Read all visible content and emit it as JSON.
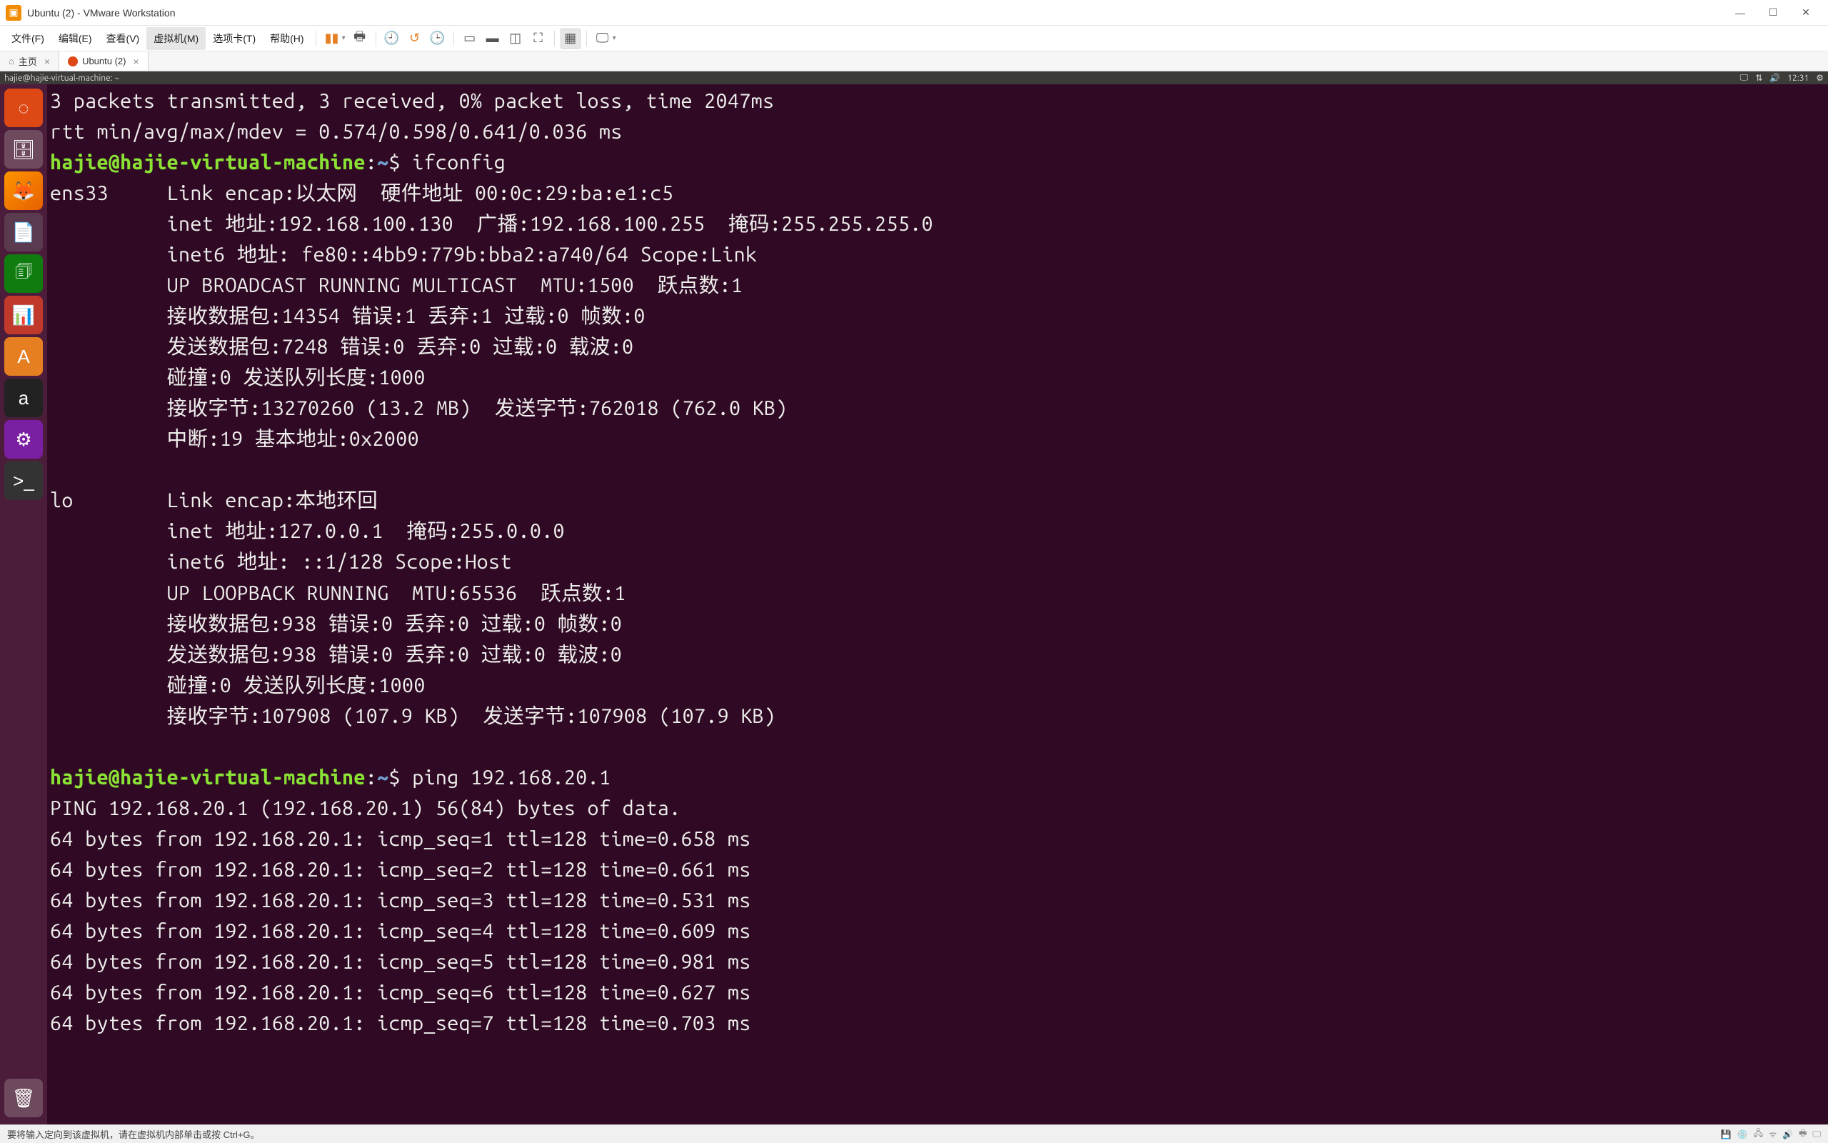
{
  "window": {
    "title": "Ubuntu (2) - VMware Workstation",
    "min_label": "—",
    "max_label": "☐",
    "close_label": "✕"
  },
  "menu": {
    "file": "文件(F)",
    "edit": "编辑(E)",
    "view": "查看(V)",
    "vm": "虚拟机(M)",
    "tabs": "选项卡(T)",
    "help": "帮助(H)"
  },
  "tabs": {
    "home": "主页",
    "vm": "Ubuntu (2)"
  },
  "ubuntu_topbar": {
    "title": "hajie@hajie-virtual-machine: ~",
    "time": "12:31"
  },
  "terminal": {
    "prompt_user": "hajie@hajie-virtual-machine",
    "prompt_path": "~",
    "prompt_dollar": "$",
    "lines_before": [
      "3 packets transmitted, 3 received, 0% packet loss, time 2047ms",
      "rtt min/avg/max/mdev = 0.574/0.598/0.641/0.036 ms"
    ],
    "cmd1": "ifconfig",
    "ifconfig_lines": [
      "ens33     Link encap:以太网  硬件地址 00:0c:29:ba:e1:c5  ",
      "          inet 地址:192.168.100.130  广播:192.168.100.255  掩码:255.255.255.0",
      "          inet6 地址: fe80::4bb9:779b:bba2:a740/64 Scope:Link",
      "          UP BROADCAST RUNNING MULTICAST  MTU:1500  跃点数:1",
      "          接收数据包:14354 错误:1 丢弃:1 过载:0 帧数:0",
      "          发送数据包:7248 错误:0 丢弃:0 过载:0 载波:0",
      "          碰撞:0 发送队列长度:1000 ",
      "          接收字节:13270260 (13.2 MB)  发送字节:762018 (762.0 KB)",
      "          中断:19 基本地址:0x2000 ",
      "",
      "lo        Link encap:本地环回  ",
      "          inet 地址:127.0.0.1  掩码:255.0.0.0",
      "          inet6 地址: ::1/128 Scope:Host",
      "          UP LOOPBACK RUNNING  MTU:65536  跃点数:1",
      "          接收数据包:938 错误:0 丢弃:0 过载:0 帧数:0",
      "          发送数据包:938 错误:0 丢弃:0 过载:0 载波:0",
      "          碰撞:0 发送队列长度:1000 ",
      "          接收字节:107908 (107.9 KB)  发送字节:107908 (107.9 KB)",
      ""
    ],
    "cmd2": "ping 192.168.20.1",
    "ping_lines": [
      "PING 192.168.20.1 (192.168.20.1) 56(84) bytes of data.",
      "64 bytes from 192.168.20.1: icmp_seq=1 ttl=128 time=0.658 ms",
      "64 bytes from 192.168.20.1: icmp_seq=2 ttl=128 time=0.661 ms",
      "64 bytes from 192.168.20.1: icmp_seq=3 ttl=128 time=0.531 ms",
      "64 bytes from 192.168.20.1: icmp_seq=4 ttl=128 time=0.609 ms",
      "64 bytes from 192.168.20.1: icmp_seq=5 ttl=128 time=0.981 ms",
      "64 bytes from 192.168.20.1: icmp_seq=6 ttl=128 time=0.627 ms",
      "64 bytes from 192.168.20.1: icmp_seq=7 ttl=128 time=0.703 ms"
    ]
  },
  "statusbar": {
    "msg": "要将输入定向到该虚拟机，请在虚拟机内部单击或按 Ctrl+G。"
  }
}
